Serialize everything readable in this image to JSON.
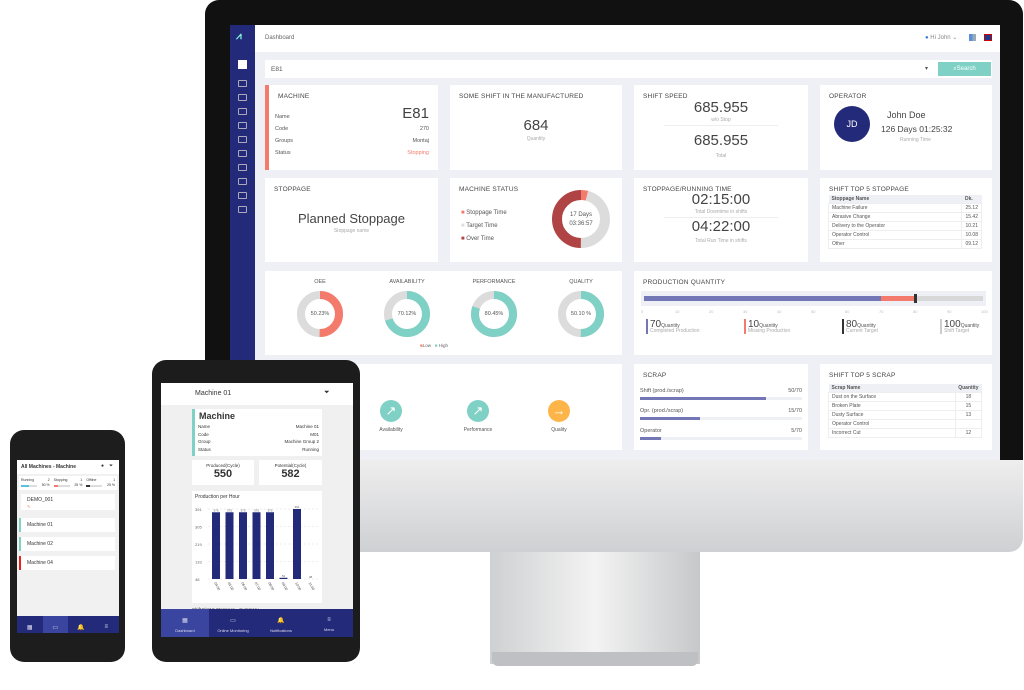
{
  "colors": {
    "navy": "#232a7a",
    "teal": "#7fd0c5",
    "coral": "#f47b6b",
    "darkred": "#b04444",
    "grey": "#dcdcdc",
    "orange": "#fdb54a",
    "purple": "#7477b5"
  },
  "desktop": {
    "breadcrumb": "Dashboard",
    "user_greeting": "Hi John",
    "search_value": "E81",
    "search_button": "Search",
    "machine": {
      "title": "MACHINE",
      "name_value": "E81",
      "rows": [
        {
          "k": "Name",
          "v": ""
        },
        {
          "k": "Code",
          "v": "270"
        },
        {
          "k": "Groups",
          "v": "Montaj"
        },
        {
          "k": "Status",
          "v": "Stopping"
        }
      ]
    },
    "shift": {
      "title": "SOME SHIFT IN THE MANUFACTURED",
      "value": "684",
      "label": "Quantity"
    },
    "speed": {
      "title": "SHIFT SPEED",
      "v1": "685.955",
      "l1": "w/o Stop",
      "v2": "685.955",
      "l2": "Total"
    },
    "operator": {
      "title": "OPERATOR",
      "initials": "JD",
      "name": "John Doe",
      "time": "126 Days 01:25:32",
      "label": "Running Time"
    },
    "stoppage": {
      "title": "STOPPAGE",
      "value": "Planned Stoppage",
      "label": "Stoppage name"
    },
    "status": {
      "title": "MACHINE STATUS",
      "legend": [
        "Stoppage Time",
        "Target Time",
        "Over Time"
      ],
      "center1": "17 Days",
      "center2": "03:36:57",
      "fractions": {
        "stoppage": 0.04,
        "target": 0.46,
        "over": 0.5
      }
    },
    "running": {
      "title": "STOPPAGE/RUNNING TIME",
      "v1": "02:15:00",
      "l1": "Total Downtime in shifts",
      "v2": "04:22:00",
      "l2": "Total Run Time in shifts"
    },
    "top_stoppage": {
      "title": "SHIFT TOP 5 STOPPAGE",
      "h1": "Stoppage Name",
      "h2": "Dk.",
      "rows": [
        [
          "Machine Failure",
          "25.12"
        ],
        [
          "Abrasive Change",
          "15.42"
        ],
        [
          "Delivery to the Operator",
          "10.21"
        ],
        [
          "Operator Control",
          "10.08"
        ],
        [
          "Other",
          "09.12"
        ]
      ]
    },
    "gauges": [
      {
        "title": "OEE",
        "label": "50.23%",
        "value": 50.23,
        "level": "low"
      },
      {
        "title": "AVAILABILITY",
        "label": "70.12%",
        "value": 70.12,
        "level": "high"
      },
      {
        "title": "PERFORMANCE",
        "label": "80.45%",
        "value": 80.45,
        "level": "high"
      },
      {
        "title": "QUALITY",
        "label": "50.10 %",
        "value": 50.1,
        "level": "high"
      }
    ],
    "gauge_legend": {
      "low": "Low",
      "high": "High"
    },
    "production": {
      "title": "PRODUCTION QUANTITY",
      "completed": 70,
      "missing": 10,
      "target": 80,
      "max": 100,
      "ticks": [
        "0",
        "10",
        "20",
        "30",
        "40",
        "50",
        "60",
        "70",
        "80",
        "90",
        "100"
      ],
      "unit": "Quantity",
      "items": [
        {
          "v": "70",
          "l": "Completed Production"
        },
        {
          "v": "10",
          "l": "Missing Production"
        },
        {
          "v": "80",
          "l": "Current Target"
        },
        {
          "v": "100",
          "l": "Shift Target"
        }
      ]
    },
    "trends": [
      {
        "label": "Availability",
        "dir": "up"
      },
      {
        "label": "Performance",
        "dir": "up"
      },
      {
        "label": "Quality",
        "dir": "right"
      }
    ],
    "scrap": {
      "title": "SCRAP",
      "rows": [
        {
          "k": "Shift (prod./scrap)",
          "v": "50/70",
          "f": 0.78
        },
        {
          "k": "Opr. (prod./scrap)",
          "v": "15/70",
          "f": 0.37
        },
        {
          "k": "Operator",
          "v": "5/70",
          "f": 0.13
        }
      ]
    },
    "top_scrap": {
      "title": "SHIFT TOP 5 SCRAP",
      "h1": "Scrap Name",
      "h2": "Quantity",
      "rows": [
        [
          "Dust on the Surface",
          "18"
        ],
        [
          "Broken Plate",
          "15"
        ],
        [
          "Dusty Surface",
          "13"
        ],
        [
          "Operator Control",
          ""
        ],
        [
          "Incorrect Cut",
          "12"
        ]
      ]
    }
  },
  "tablet": {
    "title": "Machine 01",
    "card_title": "Machine",
    "rows": [
      {
        "k": "Name",
        "v": "Machine 01"
      },
      {
        "k": "Code",
        "v": "M01"
      },
      {
        "k": "Group",
        "v": "Machine Group 2"
      },
      {
        "k": "Status",
        "v": "Running"
      }
    ],
    "produced_label": "Produced(Cycle)",
    "produced": "550",
    "potential_label": "Potential(Cycle)",
    "potential": "582",
    "summary": "Shift First 5 Stoppage - Summary",
    "nav": [
      "Dashboard",
      "Online Monitoring",
      "Notifications",
      "Menu"
    ],
    "chart_data": {
      "type": "bar",
      "title": "Production per Hour",
      "categories": [
        "04:00",
        "05:00",
        "06:00",
        "07:00",
        "08:00",
        "09:00",
        "10:00",
        "11:00"
      ],
      "values": [
        375,
        375,
        375,
        375,
        375,
        54,
        391,
        48
      ],
      "yticks": [
        "391",
        "305",
        "219",
        "133",
        "48"
      ],
      "ylim": [
        48,
        391
      ]
    }
  },
  "phone": {
    "title": "All Machines - Machine",
    "stats": [
      {
        "k": "Running",
        "n": "2",
        "p": "50 %",
        "f": 0.5,
        "c": "#5bc0de"
      },
      {
        "k": "Stopping",
        "n": "1",
        "p": "25 %",
        "f": 0.25,
        "c": "#f47b6b"
      },
      {
        "k": "Offline",
        "n": "1",
        "p": "25 %",
        "f": 0.25,
        "c": "#333"
      }
    ],
    "group": "DEMO_001",
    "machines": [
      {
        "n": "Machine 01",
        "c": "#7fd0c5"
      },
      {
        "n": "Machine 02",
        "c": "#7fd0c5"
      },
      {
        "n": "Machine 04",
        "c": "#e82020"
      }
    ],
    "nav": [
      "Dashboard",
      "Online Monitoring",
      "Notifications",
      "Menu"
    ]
  }
}
